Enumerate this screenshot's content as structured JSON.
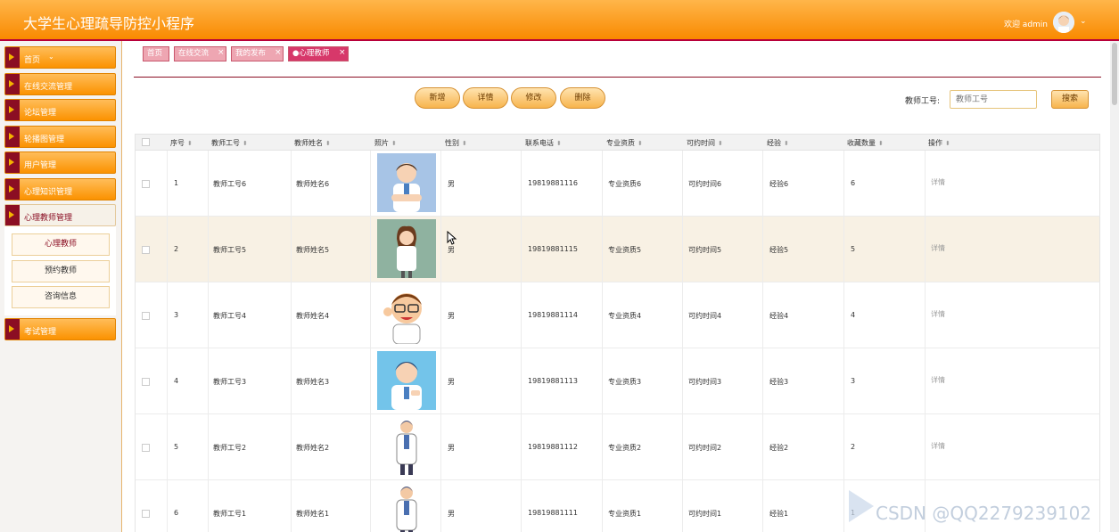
{
  "header": {
    "title": "大学生心理疏导防控小程序",
    "welcome": "欢迎 admin",
    "chevron": "⌄"
  },
  "sidebar": {
    "items": [
      {
        "label": "首页",
        "suffix": "⌄"
      },
      {
        "label": "在线交流管理"
      },
      {
        "label": "论坛管理"
      },
      {
        "label": "轮播图管理"
      },
      {
        "label": "用户管理"
      },
      {
        "label": "心理知识管理"
      },
      {
        "label": "心理教师管理"
      },
      {
        "label": "考试管理"
      }
    ],
    "submenu": [
      "心理教师",
      "预约教师",
      "咨询信息"
    ]
  },
  "tabs": [
    {
      "label": "首页"
    },
    {
      "label": "在线交流"
    },
    {
      "label": "我的发布"
    },
    {
      "label": "●心理教师"
    }
  ],
  "toolbar": {
    "add": "新增",
    "detail": "详情",
    "edit": "修改",
    "delete": "删除",
    "search_label": "教师工号:",
    "search_placeholder": "教师工号",
    "search_button": "搜索"
  },
  "table": {
    "columns": [
      "序号",
      "教师工号",
      "教师姓名",
      "照片",
      "性别",
      "联系电话",
      "专业资质",
      "可约时间",
      "经验",
      "收藏数量",
      "操作"
    ],
    "rows": [
      {
        "index": "1",
        "id": "教师工号6",
        "name": "教师姓名6",
        "gender": "男",
        "phone": "19819881116",
        "qual": "专业资质6",
        "time": "可约时间6",
        "exp": "经验6",
        "fav": "6",
        "op": "详情"
      },
      {
        "index": "2",
        "id": "教师工号5",
        "name": "教师姓名5",
        "gender": "男",
        "phone": "19819881115",
        "qual": "专业资质5",
        "time": "可约时间5",
        "exp": "经验5",
        "fav": "5",
        "op": "详情"
      },
      {
        "index": "3",
        "id": "教师工号4",
        "name": "教师姓名4",
        "gender": "男",
        "phone": "19819881114",
        "qual": "专业资质4",
        "time": "可约时间4",
        "exp": "经验4",
        "fav": "4",
        "op": "详情"
      },
      {
        "index": "4",
        "id": "教师工号3",
        "name": "教师姓名3",
        "gender": "男",
        "phone": "19819881113",
        "qual": "专业资质3",
        "time": "可约时间3",
        "exp": "经验3",
        "fav": "3",
        "op": "详情"
      },
      {
        "index": "5",
        "id": "教师工号2",
        "name": "教师姓名2",
        "gender": "男",
        "phone": "19819881112",
        "qual": "专业资质2",
        "time": "可约时间2",
        "exp": "经验2",
        "fav": "2",
        "op": "详情"
      },
      {
        "index": "6",
        "id": "教师工号1",
        "name": "教师姓名1",
        "gender": "男",
        "phone": "19819881111",
        "qual": "专业资质1",
        "time": "可约时间1",
        "exp": "经验1",
        "fav": "1",
        "op": ""
      }
    ]
  },
  "watermark": "CSDN @QQ2279239102",
  "colors": {
    "accent": "#f98a00",
    "dark": "#8b0e23",
    "tab": "#eea6b2"
  }
}
